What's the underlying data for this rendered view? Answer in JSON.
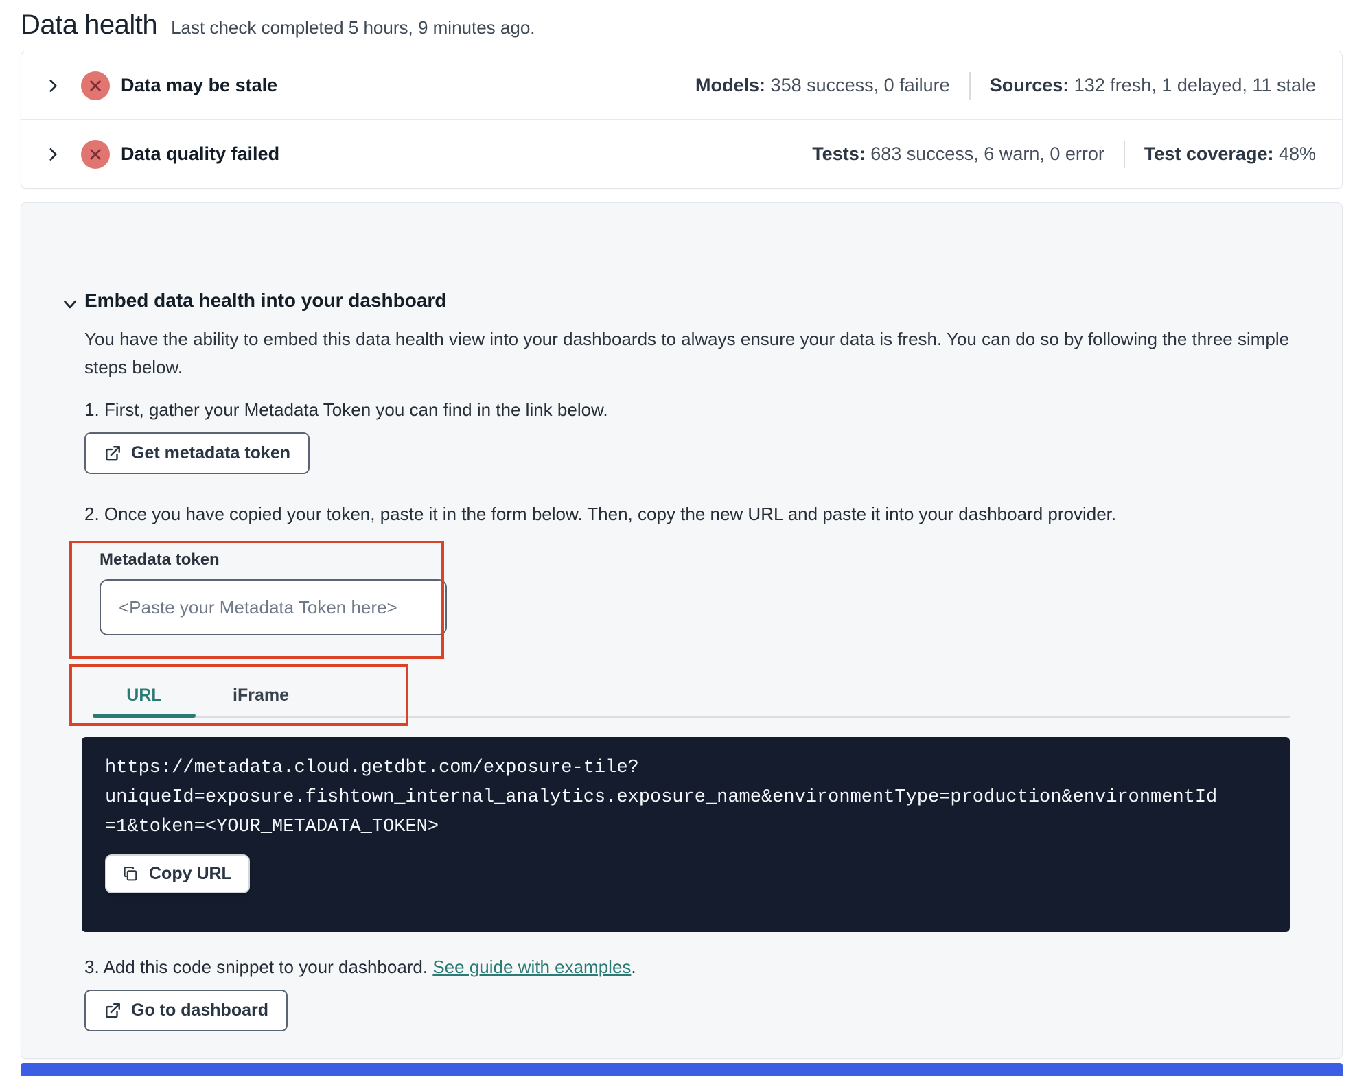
{
  "header": {
    "title": "Data health",
    "subtitle": "Last check completed 5 hours, 9 minutes ago."
  },
  "status_panels": [
    {
      "title": "Data may be stale",
      "status": "error",
      "stats": [
        {
          "label": "Models:",
          "value": " 358 success, 0 failure"
        },
        {
          "label": "Sources:",
          "value": " 132 fresh, 1 delayed, 11 stale"
        }
      ]
    },
    {
      "title": "Data quality failed",
      "status": "error",
      "stats": [
        {
          "label": "Tests:",
          "value": " 683 success, 6 warn, 0 error"
        },
        {
          "label": "Test coverage:",
          "value": " 48%"
        }
      ]
    }
  ],
  "embed": {
    "heading": "Embed data health into your dashboard",
    "description": "You have the ability to embed this data health view into your dashboards to always ensure your data is fresh. You can do so by following the three simple steps below.",
    "step_1": "1. First, gather your Metadata Token you can find in the link below.",
    "get_token_button": "Get metadata token",
    "step_2": "2. Once you have copied your token, paste it in the form below. Then, copy the new URL and paste it into your dashboard provider.",
    "token_label": "Metadata token",
    "token_placeholder": "<Paste your Metadata Token here>",
    "tabs": {
      "url": "URL",
      "iframe": "iFrame",
      "active": "URL"
    },
    "code_lines": [
      "https://metadata.cloud.getdbt.com/exposure-tile?",
      "uniqueId=exposure.fishtown_internal_analytics.exposure_name&environmentType=production&environmentId",
      "=1&token=<YOUR_METADATA_TOKEN>"
    ],
    "copy_url_button": "Copy URL",
    "step_3_prefix": "3. Add this code snippet to your dashboard. ",
    "step_3_link": "See guide with examples",
    "step_3_suffix": ".",
    "dashboard_button": "Go to dashboard"
  },
  "icons": {
    "row_expand": "chevron-right-icon",
    "section_expand": "chevron-down-icon",
    "status": "error-x-circle-icon",
    "external": "external-link-icon",
    "copy": "copy-icon"
  },
  "colors": {
    "error_icon_bg": "#e0766f",
    "error_icon_x": "#7d2d35",
    "annotation_red": "#da4327",
    "teal_accent": "#2b7a74",
    "code_block_bg": "#151c2e",
    "bottom_bar_blue": "#3b5ee4"
  }
}
